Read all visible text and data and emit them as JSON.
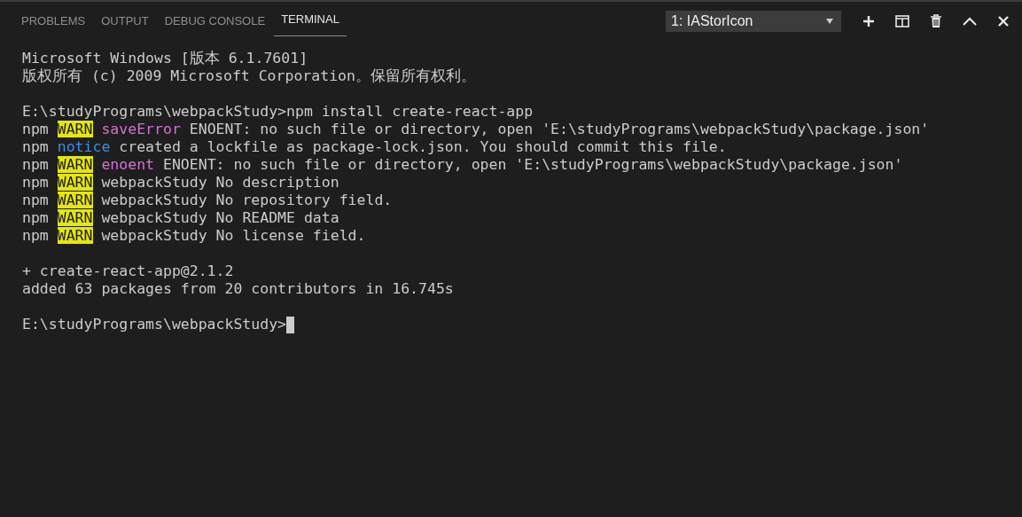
{
  "panel_tabs": [
    {
      "label": "PROBLEMS",
      "selected": false
    },
    {
      "label": "OUTPUT",
      "selected": false
    },
    {
      "label": "DEBUG CONSOLE",
      "selected": false
    },
    {
      "label": "TERMINAL",
      "selected": true
    }
  ],
  "terminal_select": {
    "value": "1: IAStorIcon"
  },
  "toolbar": [
    {
      "kind": "add"
    },
    {
      "kind": "split"
    },
    {
      "kind": "trash"
    },
    {
      "kind": "maximize"
    },
    {
      "kind": "close"
    }
  ],
  "lines": [
    {
      "kind": "text",
      "segments": [
        {
          "kind": "plain",
          "text": "Microsoft Windows [版本 6.1.7601]"
        }
      ]
    },
    {
      "kind": "text",
      "segments": [
        {
          "kind": "plain",
          "text": "版权所有 (c) 2009 Microsoft Corporation。保留所有权利。"
        }
      ]
    },
    {
      "kind": "blank"
    },
    {
      "kind": "text",
      "segments": [
        {
          "kind": "plain",
          "text": "E:\\studyPrograms\\webpackStudy>npm install create-react-app"
        }
      ]
    },
    {
      "kind": "text",
      "segments": [
        {
          "kind": "plain",
          "text": "npm "
        },
        {
          "kind": "warn",
          "text": "WARN"
        },
        {
          "kind": "tag",
          "text": " saveError"
        },
        {
          "kind": "plain",
          "text": " ENOENT: no such file or directory, open 'E:\\studyPrograms\\webpackStudy\\package.json'"
        }
      ]
    },
    {
      "kind": "text",
      "segments": [
        {
          "kind": "plain",
          "text": "npm "
        },
        {
          "kind": "notice",
          "text": "notice"
        },
        {
          "kind": "plain",
          "text": " created a lockfile as package-lock.json. You should commit this file."
        }
      ]
    },
    {
      "kind": "text",
      "segments": [
        {
          "kind": "plain",
          "text": "npm "
        },
        {
          "kind": "warn",
          "text": "WARN"
        },
        {
          "kind": "tag",
          "text": " enoent"
        },
        {
          "kind": "plain",
          "text": " ENOENT: no such file or directory, open 'E:\\studyPrograms\\webpackStudy\\package.json'"
        }
      ]
    },
    {
      "kind": "text",
      "segments": [
        {
          "kind": "plain",
          "text": "npm "
        },
        {
          "kind": "warn",
          "text": "WARN"
        },
        {
          "kind": "plain",
          "text": " webpackStudy No description"
        }
      ]
    },
    {
      "kind": "text",
      "segments": [
        {
          "kind": "plain",
          "text": "npm "
        },
        {
          "kind": "warn",
          "text": "WARN"
        },
        {
          "kind": "plain",
          "text": " webpackStudy No repository field."
        }
      ]
    },
    {
      "kind": "text",
      "segments": [
        {
          "kind": "plain",
          "text": "npm "
        },
        {
          "kind": "warn",
          "text": "WARN"
        },
        {
          "kind": "plain",
          "text": " webpackStudy No README data"
        }
      ]
    },
    {
      "kind": "text",
      "segments": [
        {
          "kind": "plain",
          "text": "npm "
        },
        {
          "kind": "warn",
          "text": "WARN"
        },
        {
          "kind": "plain",
          "text": " webpackStudy No license field."
        }
      ]
    },
    {
      "kind": "blank"
    },
    {
      "kind": "text",
      "segments": [
        {
          "kind": "plain",
          "text": "+ create-react-app@2.1.2"
        }
      ]
    },
    {
      "kind": "text",
      "segments": [
        {
          "kind": "plain",
          "text": "added 63 packages from 20 contributors in 16.745s"
        }
      ]
    },
    {
      "kind": "blank"
    },
    {
      "kind": "text",
      "cursor": true,
      "segments": [
        {
          "kind": "plain",
          "text": "E:\\studyPrograms\\webpackStudy>"
        }
      ]
    }
  ]
}
